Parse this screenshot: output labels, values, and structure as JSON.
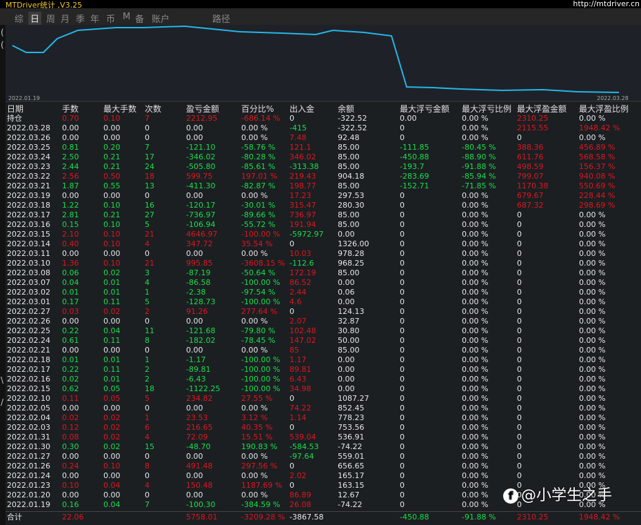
{
  "app": {
    "title": "MTDriver统计 ,V3.25",
    "website": "http://mtdriver.cn"
  },
  "tabs": [
    {
      "label": "综",
      "active": false
    },
    {
      "label": "日",
      "active": true
    },
    {
      "label": "周",
      "active": false
    },
    {
      "label": "月",
      "active": false
    },
    {
      "label": "季",
      "active": false
    },
    {
      "label": "年",
      "active": false
    },
    {
      "label": "币",
      "active": false
    },
    {
      "label": "M",
      "active": false
    },
    {
      "label": "备",
      "active": false
    },
    {
      "label": "账户",
      "active": false
    },
    {
      "label": "路径",
      "active": false
    }
  ],
  "left_marks": [
    "(",
    "(",
    "\\",
    "/"
  ],
  "chart": {
    "start_date": "2022.01.19",
    "end_date": "2022.03.28",
    "line_color": "#25b6e8"
  },
  "table": {
    "headers": [
      "日期",
      "手数",
      "最大手数",
      "次数",
      "盈亏金额",
      "百分比%",
      "出入金",
      "余额",
      "最大浮亏金额",
      "最大浮亏比例",
      "最大浮盈金额",
      "最大浮盈比例"
    ],
    "rows": [
      {
        "d": "持仓",
        "c": "r",
        "lots": "0.70",
        "maxlots": "0.10",
        "count": "7",
        "pnl": "2212.95",
        "pct": "-686.14 %",
        "io": "0",
        "io_c": "w",
        "bal": "-322.52",
        "ml": "0.00",
        "mlp": "0.00 %",
        "mp": "2310.25",
        "mpp": "0.00 %",
        "mp_c": "r",
        "mpp_c": "w"
      },
      {
        "d": "2022.03.28",
        "c": "w",
        "lots": "0.00",
        "maxlots": "0.00",
        "count": "0",
        "pnl": "0.00",
        "pct": "0.00 %",
        "io": "-415",
        "io_c": "g",
        "bal": "-322.52",
        "ml": "0",
        "mlp": "0.00 %",
        "mp": "2115.55",
        "mpp": "1948.42 %",
        "mp_c": "r",
        "mpp_c": "r"
      },
      {
        "d": "2022.03.26",
        "c": "w",
        "lots": "0.00",
        "maxlots": "0.00",
        "count": "0",
        "pnl": "0.00",
        "pct": "0.00 %",
        "io": "7.48",
        "io_c": "r",
        "bal": "92.48",
        "ml": "0",
        "mlp": "0.00 %",
        "mp": "0",
        "mpp": "0.00 %",
        "mp_c": "w",
        "mpp_c": "w"
      },
      {
        "d": "2022.03.25",
        "c": "g",
        "lots": "0.81",
        "maxlots": "0.20",
        "count": "7",
        "pnl": "-121.10",
        "pct": "-58.76 %",
        "io": "121.1",
        "io_c": "r",
        "bal": "85.00",
        "ml": "-111.85",
        "mlp": "-80.45 %",
        "mp": "388.36",
        "mpp": "456.89 %",
        "mp_c": "r",
        "mpp_c": "r"
      },
      {
        "d": "2022.03.24",
        "c": "g",
        "lots": "2.50",
        "maxlots": "0.21",
        "count": "17",
        "pnl": "-346.02",
        "pct": "-80.28 %",
        "io": "346.02",
        "io_c": "r",
        "bal": "85.00",
        "ml": "-450.88",
        "mlp": "-88.90 %",
        "mp": "611.76",
        "mpp": "568.58 %",
        "mp_c": "r",
        "mpp_c": "r"
      },
      {
        "d": "2022.03.23",
        "c": "g",
        "lots": "2.44",
        "maxlots": "0.21",
        "count": "24",
        "pnl": "-505.80",
        "pct": "-85.61 %",
        "io": "-313.38",
        "io_c": "g",
        "bal": "85.00",
        "ml": "-193.7",
        "mlp": "-91.88 %",
        "mp": "498.59",
        "mpp": "156.37 %",
        "mp_c": "r",
        "mpp_c": "r"
      },
      {
        "d": "2022.03.22",
        "c": "r",
        "lots": "2.56",
        "maxlots": "0.50",
        "count": "18",
        "pnl": "599.75",
        "pct": "197.01 %",
        "io": "219.43",
        "io_c": "r",
        "bal": "904.18",
        "ml": "-283.69",
        "mlp": "-85.94 %",
        "mp": "799.07",
        "mpp": "940.08 %",
        "mp_c": "r",
        "mpp_c": "r"
      },
      {
        "d": "2022.03.21",
        "c": "g",
        "lots": "1.87",
        "maxlots": "0.55",
        "count": "13",
        "pnl": "-411.30",
        "pct": "-82.87 %",
        "io": "198.77",
        "io_c": "r",
        "bal": "85.00",
        "ml": "-152.71",
        "mlp": "-71.85 %",
        "mp": "1170.38",
        "mpp": "550.69 %",
        "mp_c": "r",
        "mpp_c": "r"
      },
      {
        "d": "2022.03.19",
        "c": "w",
        "lots": "0.00",
        "maxlots": "0.00",
        "count": "0",
        "pnl": "0.00",
        "pct": "0.00 %",
        "io": "17.23",
        "io_c": "r",
        "bal": "297.53",
        "ml": "0",
        "mlp": "0.00 %",
        "mp": "679.67",
        "mpp": "228.44 %",
        "mp_c": "r",
        "mpp_c": "r"
      },
      {
        "d": "2022.03.18",
        "c": "g",
        "lots": "1.22",
        "maxlots": "0.10",
        "count": "16",
        "pnl": "-120.17",
        "pct": "-30.01 %",
        "io": "315.47",
        "io_c": "r",
        "bal": "280.30",
        "ml": "0",
        "mlp": "0.00 %",
        "mp": "687.32",
        "mpp": "298.69 %",
        "mp_c": "r",
        "mpp_c": "r"
      },
      {
        "d": "2022.03.17",
        "c": "g",
        "lots": "2.81",
        "maxlots": "0.21",
        "count": "27",
        "pnl": "-736.97",
        "pct": "-89.66 %",
        "io": "736.97",
        "io_c": "r",
        "bal": "85.00",
        "ml": "0",
        "mlp": "0.00 %",
        "mp": "0",
        "mpp": "0.00 %",
        "mp_c": "w",
        "mpp_c": "w"
      },
      {
        "d": "2022.03.16",
        "c": "g",
        "lots": "0.15",
        "maxlots": "0.10",
        "count": "5",
        "pnl": "-106.94",
        "pct": "-55.72 %",
        "io": "191.94",
        "io_c": "r",
        "bal": "85.00",
        "ml": "0",
        "mlp": "0.00 %",
        "mp": "0",
        "mpp": "0.00 %",
        "mp_c": "w",
        "mpp_c": "w"
      },
      {
        "d": "2022.03.15",
        "c": "r",
        "lots": "2.10",
        "maxlots": "0.10",
        "count": "21",
        "pnl": "4646.97",
        "pct": "-100.00 %",
        "io": "-5972.97",
        "io_c": "g",
        "bal": "0.00",
        "ml": "0",
        "mlp": "0.00 %",
        "mp": "0",
        "mpp": "0.00 %",
        "mp_c": "w",
        "mpp_c": "w"
      },
      {
        "d": "2022.03.14",
        "c": "r",
        "lots": "0.40",
        "maxlots": "0.10",
        "count": "4",
        "pnl": "347.72",
        "pct": "35.54 %",
        "io": "0",
        "io_c": "w",
        "bal": "1326.00",
        "ml": "0",
        "mlp": "0.00 %",
        "mp": "0",
        "mpp": "0.00 %",
        "mp_c": "w",
        "mpp_c": "w"
      },
      {
        "d": "2022.03.11",
        "c": "w",
        "lots": "0.00",
        "maxlots": "0.00",
        "count": "0",
        "pnl": "0.00",
        "pct": "0.00 %",
        "io": "10.03",
        "io_c": "r",
        "bal": "978.28",
        "ml": "0",
        "mlp": "0.00 %",
        "mp": "0",
        "mpp": "0.00 %",
        "mp_c": "w",
        "mpp_c": "w"
      },
      {
        "d": "2022.03.10",
        "c": "r",
        "lots": "1.36",
        "maxlots": "0.10",
        "count": "21",
        "pnl": "995.85",
        "pct": "-3608.15 %",
        "io": "-112.6",
        "io_c": "g",
        "bal": "968.25",
        "ml": "0",
        "mlp": "0.00 %",
        "mp": "0",
        "mpp": "0.00 %",
        "mp_c": "w",
        "mpp_c": "w"
      },
      {
        "d": "2022.03.08",
        "c": "g",
        "lots": "0.06",
        "maxlots": "0.02",
        "count": "3",
        "pnl": "-87.19",
        "pct": "-50.64 %",
        "io": "172.19",
        "io_c": "r",
        "bal": "85.00",
        "ml": "0",
        "mlp": "0.00 %",
        "mp": "0",
        "mpp": "0.00 %",
        "mp_c": "w",
        "mpp_c": "w"
      },
      {
        "d": "2022.03.07",
        "c": "g",
        "lots": "0.04",
        "maxlots": "0.01",
        "count": "4",
        "pnl": "-86.58",
        "pct": "-100.00 %",
        "io": "86.52",
        "io_c": "r",
        "bal": "0.00",
        "ml": "0",
        "mlp": "0.00 %",
        "mp": "0",
        "mpp": "0.00 %",
        "mp_c": "w",
        "mpp_c": "w"
      },
      {
        "d": "2022.03.02",
        "c": "g",
        "lots": "0.01",
        "maxlots": "0.01",
        "count": "1",
        "pnl": "-2.38",
        "pct": "-97.54 %",
        "io": "2.44",
        "io_c": "r",
        "bal": "0.06",
        "ml": "0",
        "mlp": "0.00 %",
        "mp": "0",
        "mpp": "0.00 %",
        "mp_c": "w",
        "mpp_c": "w"
      },
      {
        "d": "2022.03.01",
        "c": "g",
        "lots": "0.17",
        "maxlots": "0.11",
        "count": "5",
        "pnl": "-128.73",
        "pct": "-100.00 %",
        "io": "4.6",
        "io_c": "r",
        "bal": "0.00",
        "ml": "0",
        "mlp": "0.00 %",
        "mp": "0",
        "mpp": "0.00 %",
        "mp_c": "w",
        "mpp_c": "w"
      },
      {
        "d": "2022.02.27",
        "c": "r",
        "lots": "0.03",
        "maxlots": "0.02",
        "count": "2",
        "pnl": "91.26",
        "pct": "277.64 %",
        "io": "0",
        "io_c": "w",
        "bal": "124.13",
        "ml": "0",
        "mlp": "0.00 %",
        "mp": "0",
        "mpp": "0.00 %",
        "mp_c": "w",
        "mpp_c": "w"
      },
      {
        "d": "2022.02.26",
        "c": "w",
        "lots": "0.00",
        "maxlots": "0.00",
        "count": "0",
        "pnl": "0.00",
        "pct": "0.00 %",
        "io": "2.07",
        "io_c": "r",
        "bal": "32.87",
        "ml": "0",
        "mlp": "0.00 %",
        "mp": "0",
        "mpp": "0.00 %",
        "mp_c": "w",
        "mpp_c": "w"
      },
      {
        "d": "2022.02.25",
        "c": "g",
        "lots": "0.22",
        "maxlots": "0.04",
        "count": "11",
        "pnl": "-121.68",
        "pct": "-79.80 %",
        "io": "102.48",
        "io_c": "r",
        "bal": "30.80",
        "ml": "0",
        "mlp": "0.00 %",
        "mp": "0",
        "mpp": "0.00 %",
        "mp_c": "w",
        "mpp_c": "w"
      },
      {
        "d": "2022.02.24",
        "c": "g",
        "lots": "0.61",
        "maxlots": "0.11",
        "count": "8",
        "pnl": "-182.02",
        "pct": "-78.45 %",
        "io": "147.02",
        "io_c": "r",
        "bal": "50.00",
        "ml": "0",
        "mlp": "0.00 %",
        "mp": "0",
        "mpp": "0.00 %",
        "mp_c": "w",
        "mpp_c": "w"
      },
      {
        "d": "2022.02.21",
        "c": "w",
        "lots": "0.00",
        "maxlots": "0.00",
        "count": "0",
        "pnl": "0.00",
        "pct": "0.00 %",
        "io": "85",
        "io_c": "r",
        "bal": "85.00",
        "ml": "0",
        "mlp": "0.00 %",
        "mp": "0",
        "mpp": "0.00 %",
        "mp_c": "w",
        "mpp_c": "w"
      },
      {
        "d": "2022.02.18",
        "c": "g",
        "lots": "0.01",
        "maxlots": "0.01",
        "count": "1",
        "pnl": "-1.17",
        "pct": "-100.00 %",
        "io": "1.17",
        "io_c": "r",
        "bal": "0.00",
        "ml": "0",
        "mlp": "0.00 %",
        "mp": "0",
        "mpp": "0.00 %",
        "mp_c": "w",
        "mpp_c": "w"
      },
      {
        "d": "2022.02.17",
        "c": "g",
        "lots": "0.22",
        "maxlots": "0.11",
        "count": "2",
        "pnl": "-89.81",
        "pct": "-100.00 %",
        "io": "89.81",
        "io_c": "r",
        "bal": "0.00",
        "ml": "0",
        "mlp": "0.00 %",
        "mp": "0",
        "mpp": "0.00 %",
        "mp_c": "w",
        "mpp_c": "w"
      },
      {
        "d": "2022.02.16",
        "c": "g",
        "lots": "0.02",
        "maxlots": "0.01",
        "count": "2",
        "pnl": "-6.43",
        "pct": "-100.00 %",
        "io": "6.43",
        "io_c": "r",
        "bal": "0.00",
        "ml": "0",
        "mlp": "0.00 %",
        "mp": "0",
        "mpp": "0.00 %",
        "mp_c": "w",
        "mpp_c": "w"
      },
      {
        "d": "2022.02.15",
        "c": "g",
        "lots": "0.62",
        "maxlots": "0.05",
        "count": "18",
        "pnl": "-1122.25",
        "pct": "-100.00 %",
        "io": "34.98",
        "io_c": "r",
        "bal": "0.00",
        "ml": "0",
        "mlp": "0.00 %",
        "mp": "0",
        "mpp": "0.00 %",
        "mp_c": "w",
        "mpp_c": "w"
      },
      {
        "d": "2022.02.10",
        "c": "r",
        "lots": "0.11",
        "maxlots": "0.05",
        "count": "5",
        "pnl": "234.82",
        "pct": "27.55 %",
        "io": "0",
        "io_c": "w",
        "bal": "1087.27",
        "ml": "0",
        "mlp": "0.00 %",
        "mp": "0",
        "mpp": "0.00 %",
        "mp_c": "w",
        "mpp_c": "w"
      },
      {
        "d": "2022.02.05",
        "c": "w",
        "lots": "0.00",
        "maxlots": "0.00",
        "count": "0",
        "pnl": "0.00",
        "pct": "0.00 %",
        "io": "74.22",
        "io_c": "r",
        "bal": "852.45",
        "ml": "0",
        "mlp": "0.00 %",
        "mp": "0",
        "mpp": "0.00 %",
        "mp_c": "w",
        "mpp_c": "w"
      },
      {
        "d": "2022.02.04",
        "c": "r",
        "lots": "0.02",
        "maxlots": "0.02",
        "count": "1",
        "pnl": "23.53",
        "pct": "3.12 %",
        "io": "1.14",
        "io_c": "r",
        "bal": "778.23",
        "ml": "0",
        "mlp": "0.00 %",
        "mp": "0",
        "mpp": "0.00 %",
        "mp_c": "w",
        "mpp_c": "w"
      },
      {
        "d": "2022.02.03",
        "c": "r",
        "lots": "0.12",
        "maxlots": "0.02",
        "count": "6",
        "pnl": "216.65",
        "pct": "40.35 %",
        "io": "0",
        "io_c": "w",
        "bal": "753.56",
        "ml": "0",
        "mlp": "0.00 %",
        "mp": "0",
        "mpp": "0.00 %",
        "mp_c": "w",
        "mpp_c": "w"
      },
      {
        "d": "2022.01.31",
        "c": "r",
        "lots": "0.08",
        "maxlots": "0.02",
        "count": "4",
        "pnl": "72.09",
        "pct": "15.51 %",
        "io": "539.04",
        "io_c": "r",
        "bal": "536.91",
        "ml": "0",
        "mlp": "0.00 %",
        "mp": "0",
        "mpp": "0.00 %",
        "mp_c": "w",
        "mpp_c": "w"
      },
      {
        "d": "2022.01.30",
        "c": "g",
        "lots": "0.30",
        "maxlots": "0.02",
        "count": "15",
        "pnl": "-48.70",
        "pct": "190.83 %",
        "io": "-584.53",
        "io_c": "g",
        "bal": "-74.22",
        "ml": "0",
        "mlp": "0.00 %",
        "mp": "0",
        "mpp": "0.00 %",
        "mp_c": "w",
        "mpp_c": "w"
      },
      {
        "d": "2022.01.27",
        "c": "w",
        "lots": "0.00",
        "maxlots": "0.00",
        "count": "0",
        "pnl": "0.00",
        "pct": "0.00 %",
        "io": "-97.64",
        "io_c": "g",
        "bal": "559.01",
        "ml": "0",
        "mlp": "0.00 %",
        "mp": "0",
        "mpp": "0.00 %",
        "mp_c": "w",
        "mpp_c": "w"
      },
      {
        "d": "2022.01.26",
        "c": "r",
        "lots": "0.24",
        "maxlots": "0.10",
        "count": "8",
        "pnl": "491.48",
        "pct": "297.56 %",
        "io": "0",
        "io_c": "w",
        "bal": "656.65",
        "ml": "0",
        "mlp": "0.00 %",
        "mp": "0",
        "mpp": "0.00 %",
        "mp_c": "w",
        "mpp_c": "w"
      },
      {
        "d": "2022.01.24",
        "c": "w",
        "lots": "0.00",
        "maxlots": "0.00",
        "count": "0",
        "pnl": "0.00",
        "pct": "0.00 %",
        "io": "2.02",
        "io_c": "r",
        "bal": "165.17",
        "ml": "0",
        "mlp": "0.00 %",
        "mp": "0",
        "mpp": "0.00 %",
        "mp_c": "w",
        "mpp_c": "w"
      },
      {
        "d": "2022.01.23",
        "c": "r",
        "lots": "0.10",
        "maxlots": "0.04",
        "count": "4",
        "pnl": "150.48",
        "pct": "1187.69 %",
        "io": "0",
        "io_c": "w",
        "bal": "163.15",
        "ml": "0",
        "mlp": "0.00 %",
        "mp": "0",
        "mpp": "0.00 %",
        "mp_c": "w",
        "mpp_c": "w"
      },
      {
        "d": "2022.01.20",
        "c": "w",
        "lots": "0.00",
        "maxlots": "0.00",
        "count": "0",
        "pnl": "0.00",
        "pct": "0.00 %",
        "io": "86.89",
        "io_c": "r",
        "bal": "12.67",
        "ml": "0",
        "mlp": "0.00 %",
        "mp": "0",
        "mpp": "0.00 %",
        "mp_c": "w",
        "mpp_c": "w"
      },
      {
        "d": "2022.01.19",
        "c": "g",
        "lots": "0.16",
        "maxlots": "0.04",
        "count": "7",
        "pnl": "-100.30",
        "pct": "-384.59 %",
        "io": "26.08",
        "io_c": "r",
        "bal": "-74.22",
        "ml": "0",
        "mlp": "0.00 %",
        "mp": "0",
        "mpp": "0.00 %",
        "mp_c": "w",
        "mpp_c": "w"
      }
    ],
    "total": {
      "d": "合计",
      "lots": "22.06",
      "pnl": "5758.01",
      "pct": "-3209.28 %",
      "io": "-3867.58",
      "ml": "-450.88",
      "mlp": "-91.88 %",
      "mp": "2310.25",
      "mpp": "1948.42 %"
    }
  },
  "watermark": {
    "logo_glyph": "f",
    "text": "@小学生之手"
  }
}
